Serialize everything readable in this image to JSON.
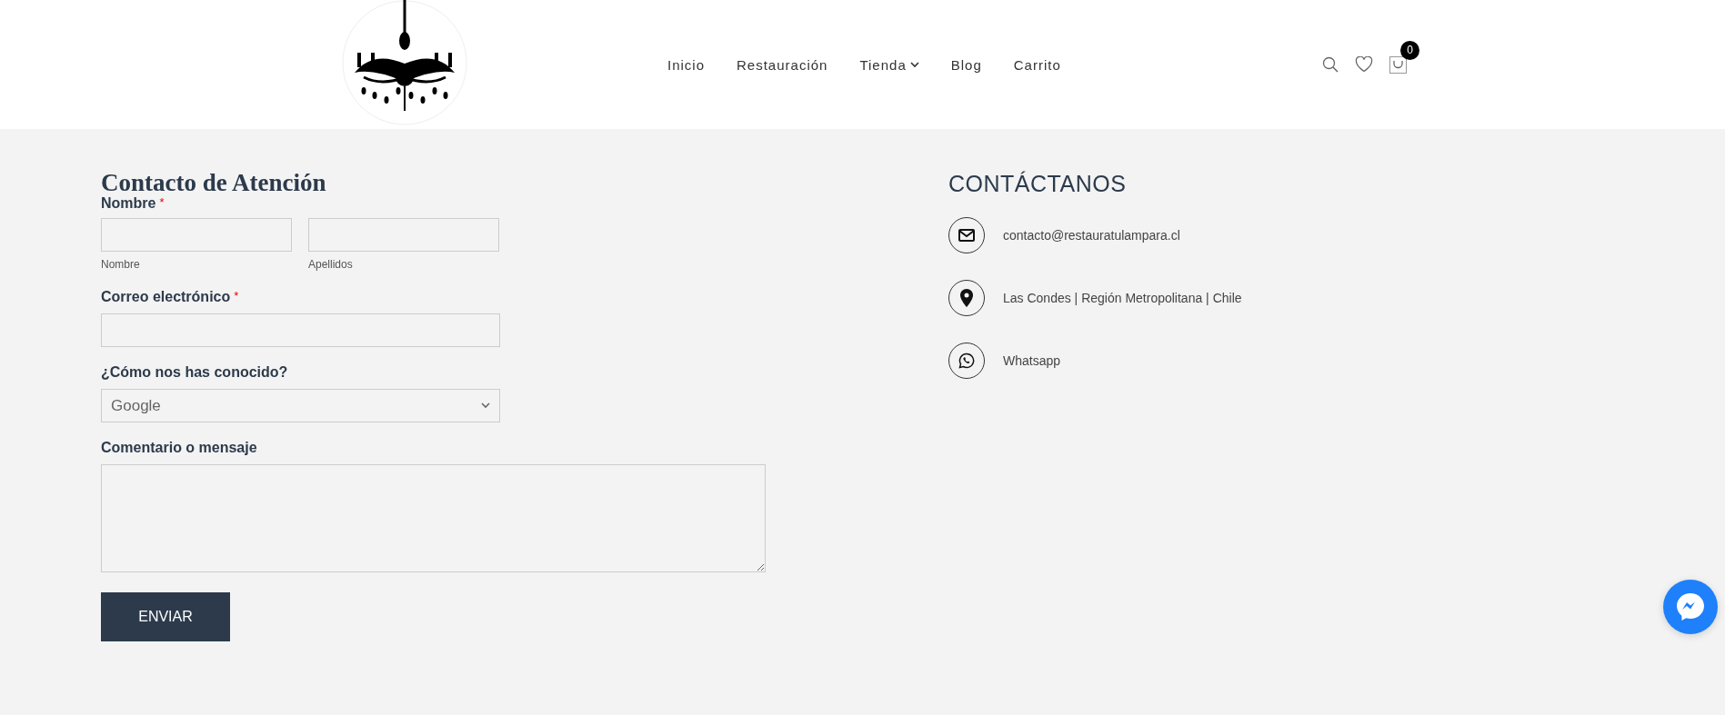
{
  "header": {
    "nav": [
      {
        "label": "Inicio",
        "has_dropdown": false
      },
      {
        "label": "Restauración",
        "has_dropdown": false
      },
      {
        "label": "Tienda",
        "has_dropdown": true
      },
      {
        "label": "Blog",
        "has_dropdown": false
      },
      {
        "label": "Carrito",
        "has_dropdown": false
      }
    ],
    "cart_count": "0"
  },
  "form": {
    "title": "Contacto de Atención",
    "required_mark": "*",
    "fields": [
      {
        "kind": "name",
        "label": "Nombre",
        "required": true,
        "sublabels": [
          "Nombre",
          "Apellidos"
        ]
      },
      {
        "kind": "text",
        "label": "Correo electrónico",
        "required": true
      },
      {
        "kind": "select",
        "label": "¿Cómo nos has conocido?",
        "required": false,
        "value": "Google"
      },
      {
        "kind": "textarea",
        "label": "Comentario o mensaje",
        "required": false
      }
    ],
    "submit": "ENVIAR"
  },
  "contact": {
    "title": "CONTÁCTANOS",
    "items": [
      {
        "kind": "email",
        "text": "contacto@restauratulampara.cl"
      },
      {
        "kind": "location",
        "text": "Las Condes | Región Metropolitana | Chile"
      },
      {
        "kind": "whatsapp",
        "text": "Whatsapp"
      }
    ]
  }
}
